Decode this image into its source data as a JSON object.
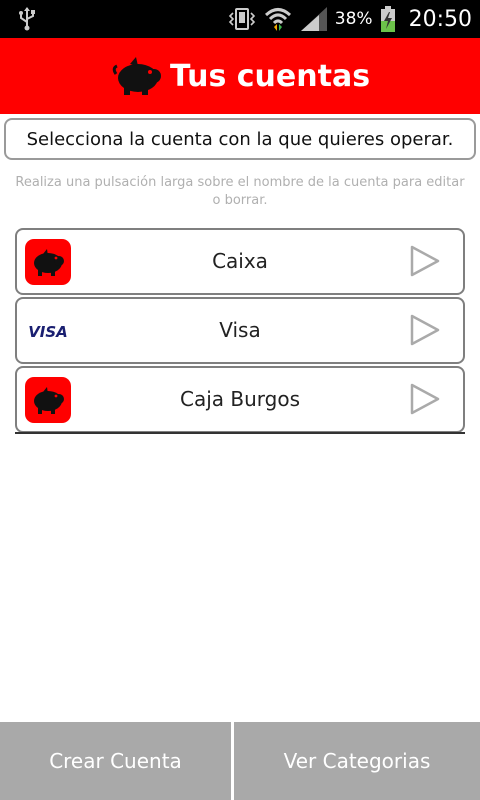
{
  "status_bar": {
    "battery_percent": "38%",
    "time": "20:50",
    "icons": [
      "usb-icon",
      "vibrate-icon",
      "wifi-icon",
      "signal-icon",
      "battery-charging-icon"
    ]
  },
  "header": {
    "title": "Tus cuentas",
    "icon": "piggy-bank-icon",
    "background": "#ff0000"
  },
  "instruction": "Selecciona la cuenta con la que quieres operar.",
  "hint": "Realiza una pulsación larga sobre el nombre de la cuenta para editar o borrar.",
  "accounts": [
    {
      "name": "Caixa",
      "icon": "piggy-bank-icon"
    },
    {
      "name": "Visa",
      "icon": "visa-card-icon",
      "icon_text": "VISA"
    },
    {
      "name": "Caja Burgos",
      "icon": "piggy-bank-icon"
    }
  ],
  "buttons": {
    "create": "Crear Cuenta",
    "categories": "Ver Categorias"
  }
}
